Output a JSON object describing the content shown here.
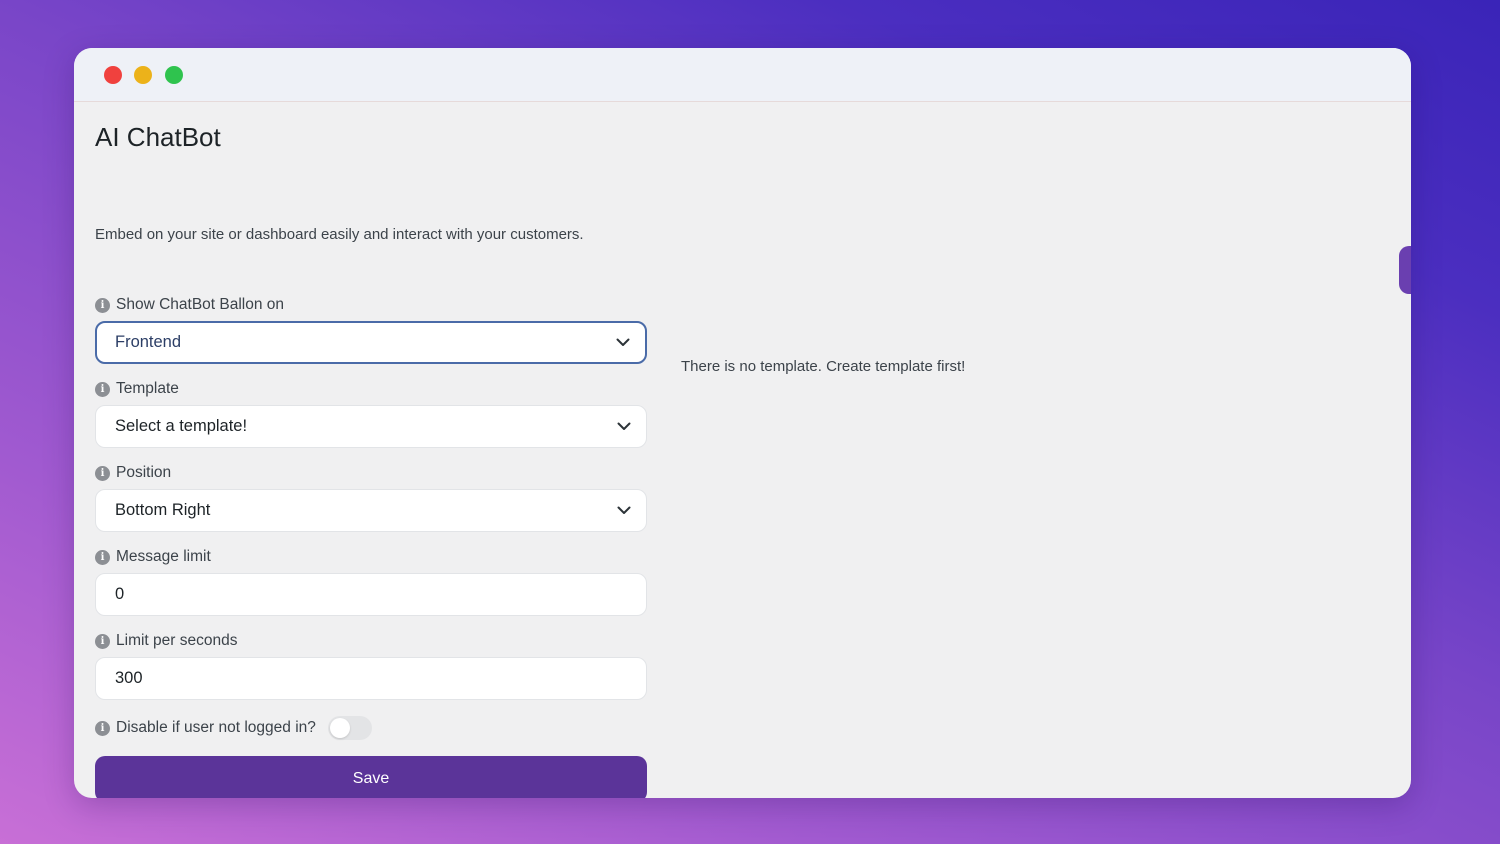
{
  "window": {
    "controls": [
      "close",
      "minimize",
      "maximize"
    ]
  },
  "page": {
    "title": "AI ChatBot",
    "description": "Embed on your site or dashboard easily and interact with your customers."
  },
  "form": {
    "show_balloon": {
      "label": "Show ChatBot Ballon on",
      "value": "Frontend"
    },
    "template": {
      "label": "Template",
      "value": "Select a template!"
    },
    "position": {
      "label": "Position",
      "value": "Bottom Right"
    },
    "message_limit": {
      "label": "Message limit",
      "value": "0"
    },
    "limit_per_seconds": {
      "label": "Limit per seconds",
      "value": "300"
    },
    "disable_logged_out": {
      "label": "Disable if user not logged in?",
      "checked": false
    },
    "save_label": "Save"
  },
  "notice": "There is no template. Create template first!",
  "colors": {
    "accent": "#5b3499",
    "focus_border": "#4a6ba8",
    "close": "#f0413e",
    "minimize": "#ecb21a",
    "maximize": "#2fc34e"
  }
}
